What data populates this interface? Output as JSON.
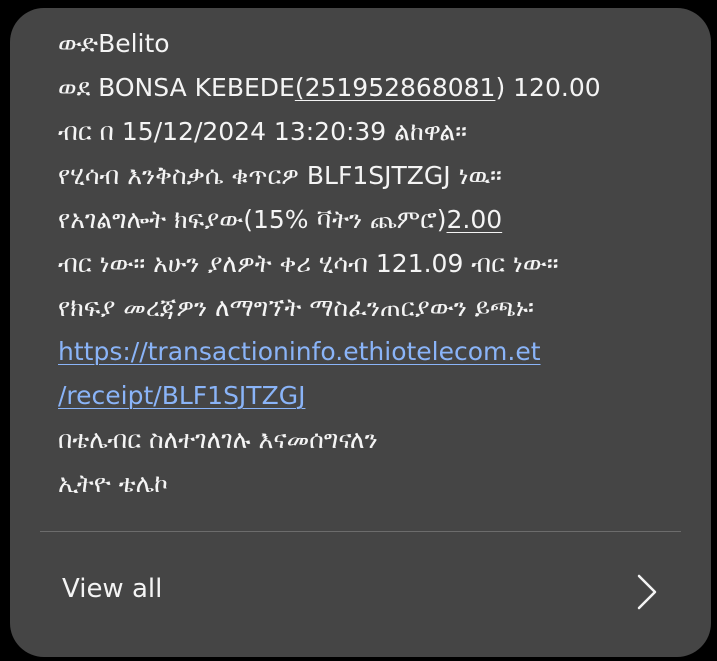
{
  "message": {
    "sender_line": "ውድBelito",
    "line2": {
      "before": "ወደ BONSA KEBEDE",
      "phone": "(251952868081",
      "after": ") 120.00"
    },
    "line3": "ብር በ 15/12/2024 13:20:39 ልከዋል።",
    "line4": "የሂሳብ እንቅስቃሴ ቁጥርዎ BLF1SJTZGJ ነዉ።",
    "line5": {
      "before": "የአገልግሎት ክፍያው(15% ቫትን ጨምሮ)",
      "fee": "2.00"
    },
    "line6": "ብር ነው። አሁን ያለዎት ቀሪ ሂሳብ 121.09 ብር ነው።",
    "line7": "የክፍያ መረጃዎን ለማግኘት ማስፈንጠርያውን ይጫኑ፡",
    "link_line1": "https://transactioninfo.ethiotelecom.et",
    "link_line2": "/receipt/BLF1SJTZGJ",
    "line10": "በቴሌብር ስለተገለገሉ እናመሰግናለን",
    "line11": "ኢትዮ ቴሌኮ"
  },
  "footer": {
    "view_all": "View all",
    "icon": "chevron-right-icon"
  },
  "colors": {
    "card_bg": "#454545",
    "text": "#f4f4f4",
    "link": "#8ab4f8",
    "divider": "#6c6c6c"
  }
}
